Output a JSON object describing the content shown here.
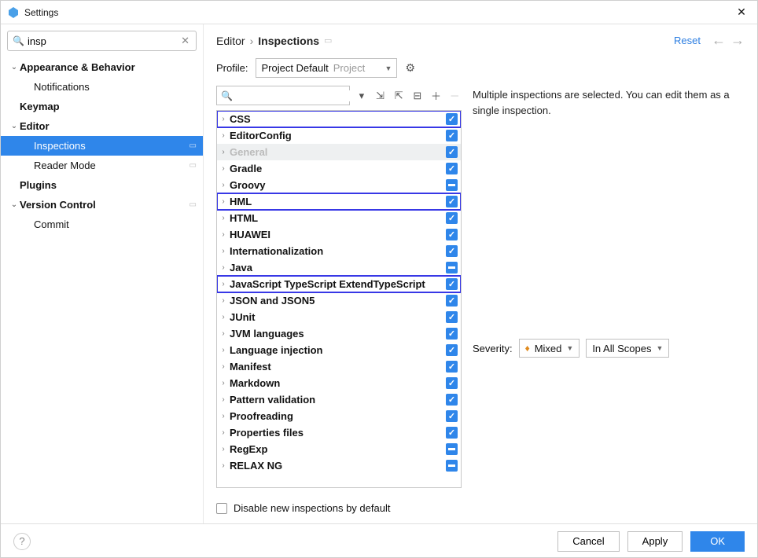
{
  "window": {
    "title": "Settings"
  },
  "search": {
    "value": "insp"
  },
  "sidebar": [
    {
      "label": "Appearance & Behavior",
      "bold": true,
      "level": 0,
      "expandable": true
    },
    {
      "label": "Notifications",
      "bold": false,
      "level": 1
    },
    {
      "label": "Keymap",
      "bold": true,
      "level": 0
    },
    {
      "label": "Editor",
      "bold": true,
      "level": 0,
      "expandable": true
    },
    {
      "label": "Inspections",
      "bold": false,
      "level": 1,
      "selected": true,
      "pin": true
    },
    {
      "label": "Reader Mode",
      "bold": false,
      "level": 1,
      "pin": true
    },
    {
      "label": "Plugins",
      "bold": true,
      "level": 0
    },
    {
      "label": "Version Control",
      "bold": true,
      "level": 0,
      "expandable": true,
      "pin": true
    },
    {
      "label": "Commit",
      "bold": false,
      "level": 1
    }
  ],
  "breadcrumb": {
    "first": "Editor",
    "second": "Inspections"
  },
  "reset_label": "Reset",
  "profile": {
    "label": "Profile:",
    "primary": "Project Default",
    "secondary": "Project"
  },
  "inspections": [
    {
      "name": "CSS",
      "state": "on",
      "hl": true
    },
    {
      "name": "EditorConfig",
      "state": "on"
    },
    {
      "name": "General",
      "state": "on",
      "sel": true
    },
    {
      "name": "Gradle",
      "state": "on"
    },
    {
      "name": "Groovy",
      "state": "mixed"
    },
    {
      "name": "HML",
      "state": "on",
      "hl": true
    },
    {
      "name": "HTML",
      "state": "on"
    },
    {
      "name": "HUAWEI",
      "state": "on"
    },
    {
      "name": "Internationalization",
      "state": "on"
    },
    {
      "name": "Java",
      "state": "mixed"
    },
    {
      "name": "JavaScript TypeScript ExtendTypeScript",
      "state": "on",
      "hl": true
    },
    {
      "name": "JSON and JSON5",
      "state": "on"
    },
    {
      "name": "JUnit",
      "state": "on"
    },
    {
      "name": "JVM languages",
      "state": "on"
    },
    {
      "name": "Language injection",
      "state": "on"
    },
    {
      "name": "Manifest",
      "state": "on"
    },
    {
      "name": "Markdown",
      "state": "on"
    },
    {
      "name": "Pattern validation",
      "state": "on"
    },
    {
      "name": "Proofreading",
      "state": "on"
    },
    {
      "name": "Properties files",
      "state": "on"
    },
    {
      "name": "RegExp",
      "state": "mixed"
    },
    {
      "name": "RELAX NG",
      "state": "mixed"
    }
  ],
  "description": "Multiple inspections are selected. You can edit them as a single inspection.",
  "severity": {
    "label": "Severity:",
    "value": "Mixed",
    "scope": "In All Scopes"
  },
  "disable_label": "Disable new inspections by default",
  "buttons": {
    "cancel": "Cancel",
    "apply": "Apply",
    "ok": "OK"
  }
}
